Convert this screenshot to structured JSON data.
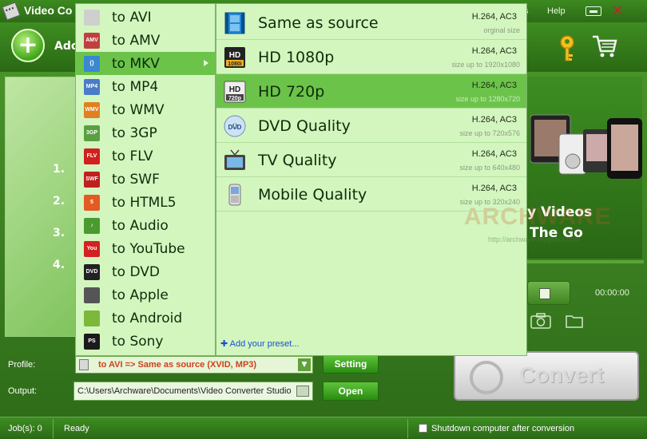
{
  "app": {
    "title": "Video Co",
    "menu_partial": "s",
    "menu_help": "Help",
    "add_label": "Ado"
  },
  "steps": [
    "1.",
    "2.",
    "3.",
    "4."
  ],
  "preview": {
    "tagline_1": "y Videos",
    "tagline_2": "The Go",
    "time": "00:00:00"
  },
  "menu_left": {
    "items": [
      {
        "label": "to AVI",
        "icon": "avi-icon",
        "icon_text": "",
        "color": "#cfcfcf"
      },
      {
        "label": "to AMV",
        "icon": "amv-icon",
        "icon_text": "AMV",
        "color": "#c04040"
      },
      {
        "label": "to MKV",
        "icon": "mkv-icon",
        "icon_text": "{}",
        "color": "#3a88d0",
        "selected": true
      },
      {
        "label": "to MP4",
        "icon": "mp4-icon",
        "icon_text": "MP4",
        "color": "#4a7cc8"
      },
      {
        "label": "to WMV",
        "icon": "wmv-icon",
        "icon_text": "WMV",
        "color": "#e08020"
      },
      {
        "label": "to 3GP",
        "icon": "3gp-icon",
        "icon_text": "3GP",
        "color": "#5aa040"
      },
      {
        "label": "to FLV",
        "icon": "flv-icon",
        "icon_text": "FLV",
        "color": "#d02020"
      },
      {
        "label": "to SWF",
        "icon": "swf-icon",
        "icon_text": "SWF",
        "color": "#c02020"
      },
      {
        "label": "to HTML5",
        "icon": "html5-icon",
        "icon_text": "5",
        "color": "#e35a22"
      },
      {
        "label": "to Audio",
        "icon": "audio-icon",
        "icon_text": "♪",
        "color": "#4a9a30"
      },
      {
        "label": "to YouTube",
        "icon": "youtube-icon",
        "icon_text": "You",
        "color": "#d32222"
      },
      {
        "label": "to DVD",
        "icon": "dvd-icon",
        "icon_text": "DVD",
        "color": "#222222"
      },
      {
        "label": "to Apple",
        "icon": "apple-icon",
        "icon_text": "",
        "color": "#555555"
      },
      {
        "label": "to Android",
        "icon": "android-icon",
        "icon_text": "",
        "color": "#7cb83a"
      },
      {
        "label": "to Sony",
        "icon": "sony-icon",
        "icon_text": "PS",
        "color": "#1a1a1a"
      }
    ]
  },
  "menu_right": {
    "items": [
      {
        "label": "Same as source",
        "codec": "H.264, AC3",
        "size": "orginal size",
        "icon": "film-strip-icon"
      },
      {
        "label": "HD 1080p",
        "codec": "H.264, AC3",
        "size": "size up to 1920x1080",
        "icon": "hd-1080i-icon"
      },
      {
        "label": "HD 720p",
        "codec": "H.264, AC3",
        "size": "size up to 1280x720",
        "icon": "hd-720p-icon",
        "selected": true
      },
      {
        "label": "DVD Quality",
        "codec": "H.264, AC3",
        "size": "size up to 720x576",
        "icon": "dvd-disc-icon"
      },
      {
        "label": "TV Quality",
        "codec": "H.264, AC3",
        "size": "size up to 640x480",
        "icon": "tv-icon"
      },
      {
        "label": "Mobile Quality",
        "codec": "H.264, AC3",
        "size": "size up to 320x240",
        "icon": "mobile-phone-icon"
      }
    ],
    "add_preset": "Add your preset..."
  },
  "watermark": {
    "logo": "ARCHWARE",
    "url": "http://archware.blogspot.com"
  },
  "controls": {
    "profile_label": "Profile:",
    "profile_value": "to AVI => Same as source (XVID, MP3)",
    "setting_label": "Setting",
    "output_label": "Output:",
    "output_value": "C:\\Users\\Archware\\Documents\\Video Converter Studio",
    "open_label": "Open",
    "convert_label": "Convert"
  },
  "status": {
    "jobs": "Job(s): 0",
    "state": "Ready",
    "shutdown_label": "Shutdown computer after conversion"
  },
  "colors": {
    "menu_bg": "#d3f6bf",
    "menu_selected": "#6cc34a",
    "window_green": "#3c8a20",
    "preset_link": "#1a4fd0",
    "profile_text": "#d0401e"
  }
}
